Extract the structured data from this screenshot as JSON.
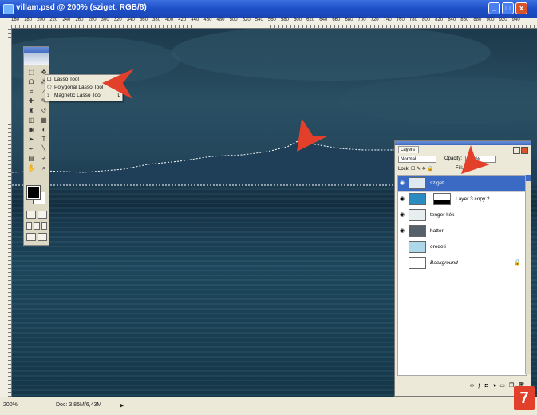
{
  "window": {
    "title": "villam.psd @ 200% (sziget, RGB/8)",
    "min_label": "_",
    "max_label": "□",
    "close_label": "x"
  },
  "ruler": {
    "ticks": [
      "160",
      "180",
      "200",
      "220",
      "240",
      "260",
      "280",
      "300",
      "320",
      "340",
      "360",
      "380",
      "400",
      "420",
      "440",
      "460",
      "480",
      "500",
      "520",
      "540",
      "560",
      "580",
      "600",
      "620",
      "640",
      "660",
      "680",
      "700",
      "720",
      "740",
      "760",
      "780",
      "800",
      "820",
      "840",
      "860",
      "880",
      "900",
      "920",
      "940"
    ]
  },
  "status_bar": {
    "zoom": "200%",
    "doc_info": "Doc: 3,85M/6,43M"
  },
  "lasso_flyout": {
    "items": [
      {
        "label": "Lasso Tool",
        "key": ""
      },
      {
        "label": "Polygonal Lasso Tool",
        "key": "L"
      },
      {
        "label": "Magnetic Lasso Tool",
        "key": "L"
      }
    ]
  },
  "layers_panel": {
    "tab": "Layers",
    "blend_mode": "Normal",
    "opacity_label": "Opacity:",
    "opacity_value": "100%",
    "lock_label": "Lock:",
    "fill_label": "Fill:",
    "layers": [
      {
        "name": "sziget",
        "selected": true,
        "visible": true
      },
      {
        "name": "Layer 3 copy 2",
        "selected": false,
        "visible": true,
        "has_mask": true
      },
      {
        "name": "tenger kék",
        "selected": false,
        "visible": true
      },
      {
        "name": "hatter",
        "selected": false,
        "visible": true
      },
      {
        "name": "eredeti",
        "selected": false,
        "visible": false
      },
      {
        "name": "Background",
        "selected": false,
        "visible": false,
        "locked": true
      }
    ]
  },
  "step_badge": "7",
  "colors": {
    "annotation_arrow": "#e2402b",
    "selection_highlight": "#3a6ac4",
    "title_bar": "#1e4fc7"
  }
}
